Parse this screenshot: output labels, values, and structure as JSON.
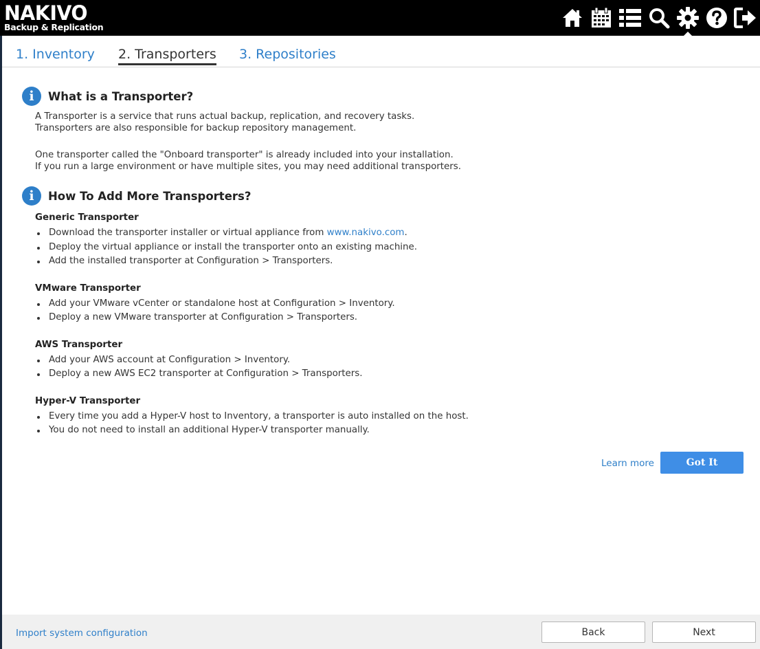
{
  "header": {
    "brand": "NAKIVO",
    "brand_sub": "Backup & Replication",
    "icons": [
      "home-icon",
      "calendar-icon",
      "list-icon",
      "search-icon",
      "gear-icon",
      "help-icon",
      "logout-icon"
    ],
    "active_icon": "gear-icon"
  },
  "tabs": [
    {
      "label": "1. Inventory",
      "active": false
    },
    {
      "label": "2. Transporters",
      "active": true
    },
    {
      "label": "3. Repositories",
      "active": false
    }
  ],
  "section1": {
    "title": "What is a Transporter?",
    "lines_a": [
      "A Transporter is a service that runs actual backup, replication, and recovery tasks.",
      "Transporters are also responsible for backup repository management."
    ],
    "lines_b": [
      "One transporter called the \"Onboard transporter\" is already included into your installation.",
      "If you run a large environment or have multiple sites, you may need additional transporters."
    ]
  },
  "section2": {
    "title": "How To Add More Transporters?",
    "groups": [
      {
        "name": "Generic Transporter",
        "bullets": [
          {
            "pre": "Download the transporter installer or virtual appliance from ",
            "link": "www.nakivo.com",
            "post": "."
          },
          {
            "pre": "Deploy the virtual appliance or install the transporter onto an existing machine."
          },
          {
            "pre": "Add the installed transporter at Configuration > Transporters."
          }
        ]
      },
      {
        "name": "VMware Transporter",
        "bullets": [
          {
            "pre": "Add your VMware vCenter or standalone host at Configuration > Inventory."
          },
          {
            "pre": "Deploy a new VMware transporter at Configuration > Transporters."
          }
        ]
      },
      {
        "name": "AWS Transporter",
        "bullets": [
          {
            "pre": "Add your AWS account at Configuration > Inventory."
          },
          {
            "pre": "Deploy a new AWS EC2 transporter at Configuration > Transporters."
          }
        ]
      },
      {
        "name": "Hyper-V Transporter",
        "bullets": [
          {
            "pre": "Every time you add a Hyper-V host to Inventory, a transporter is auto installed on the host."
          },
          {
            "pre": "You do not need to install an additional Hyper-V transporter manually."
          }
        ]
      }
    ]
  },
  "actions": {
    "learn_more": "Learn more",
    "got_it": "Got It"
  },
  "footer": {
    "import_link": "Import system configuration",
    "back": "Back",
    "next": "Next"
  },
  "colors": {
    "accent": "#2e7fc9",
    "primary_button": "#3f8ee6"
  }
}
